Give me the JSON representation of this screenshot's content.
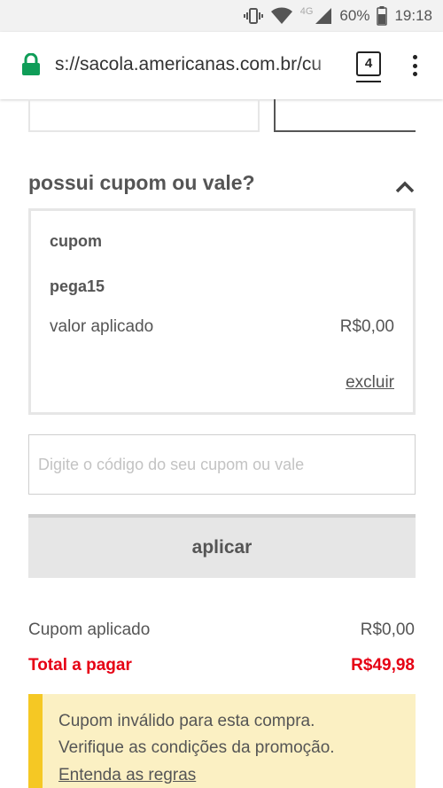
{
  "status_bar": {
    "network": "4G",
    "battery": "60%",
    "time": "19:18"
  },
  "browser": {
    "url": "s://sacola.americanas.com.br/cu",
    "tab_count": "4"
  },
  "coupon_section": {
    "title": "possui cupom ou vale?",
    "applied_box": {
      "label": "cupom",
      "code": "pega15",
      "value_label": "valor aplicado",
      "value": "R$0,00",
      "remove_label": "excluir"
    },
    "input_placeholder": "Digite o código do seu cupom ou vale",
    "apply_label": "aplicar"
  },
  "summary": {
    "coupon_label": "Cupom aplicado",
    "coupon_value": "R$0,00",
    "total_label": "Total a pagar",
    "total_value": "R$49,98"
  },
  "alert": {
    "line1": "Cupom inválido para esta compra.",
    "line2": "Verifique as condições da promoção.",
    "link": "Entenda as regras"
  },
  "colors": {
    "accent_red": "#e60014",
    "alert_bg": "#fbf0c3",
    "alert_border": "#f5c824",
    "lock_green": "#0f9d58"
  }
}
